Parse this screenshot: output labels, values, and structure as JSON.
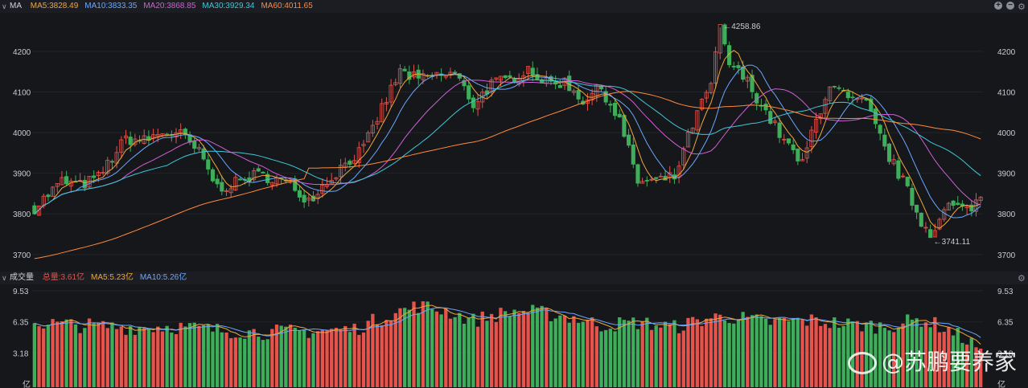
{
  "header_main": {
    "label": "MA",
    "items": [
      {
        "text": "MA5:3828.49",
        "color": "#f0a73b"
      },
      {
        "text": "MA10:3833.35",
        "color": "#6aa8ff"
      },
      {
        "text": "MA20:3868.85",
        "color": "#d35ed8"
      },
      {
        "text": "MA30:3929.34",
        "color": "#3ec8d8"
      },
      {
        "text": "MA60:4011.65",
        "color": "#ff8a3d"
      }
    ]
  },
  "header_vol": {
    "label": "成交量",
    "items": [
      {
        "text": "总量:3.61亿",
        "color": "#e5534b"
      },
      {
        "text": "MA5:5.23亿",
        "color": "#f0a73b"
      },
      {
        "text": "MA10:5.26亿",
        "color": "#6aa8ff"
      }
    ]
  },
  "watermark": "@苏鹏要养家",
  "colors": {
    "up": "#e5534b",
    "down": "#3fae5a",
    "ma5": "#f0a73b",
    "ma10": "#6aa8ff",
    "ma20": "#d35ed8",
    "ma30": "#3ec8d8",
    "ma60": "#ff8a3d"
  },
  "chart_data": [
    {
      "type": "candlestick",
      "title": "",
      "ylim": [
        3670,
        4275
      ],
      "y_ticks": [
        "4200",
        "4100",
        "4000",
        "3900",
        "3800",
        "3700"
      ],
      "annotations": [
        {
          "text": "←4258.86",
          "value": 4258.86,
          "index": 150
        },
        {
          "text": "←3741.11",
          "value": 3741.11,
          "index": 196
        }
      ],
      "anchors": [
        [
          0,
          3815
        ],
        [
          6,
          3880
        ],
        [
          10,
          3870
        ],
        [
          14,
          3890
        ],
        [
          20,
          3985
        ],
        [
          24,
          3980
        ],
        [
          28,
          4000
        ],
        [
          32,
          3995
        ],
        [
          36,
          3950
        ],
        [
          40,
          3865
        ],
        [
          44,
          3875
        ],
        [
          48,
          3895
        ],
        [
          52,
          3890
        ],
        [
          56,
          3870
        ],
        [
          60,
          3835
        ],
        [
          64,
          3880
        ],
        [
          68,
          3925
        ],
        [
          72,
          3960
        ],
        [
          76,
          4060
        ],
        [
          80,
          4150
        ],
        [
          84,
          4130
        ],
        [
          88,
          4140
        ],
        [
          92,
          4145
        ],
        [
          96,
          4070
        ],
        [
          100,
          4120
        ],
        [
          104,
          4130
        ],
        [
          108,
          4160
        ],
        [
          112,
          4120
        ],
        [
          116,
          4125
        ],
        [
          120,
          4080
        ],
        [
          124,
          4110
        ],
        [
          128,
          4030
        ],
        [
          132,
          3880
        ],
        [
          136,
          3880
        ],
        [
          140,
          3890
        ],
        [
          144,
          4020
        ],
        [
          148,
          4120
        ],
        [
          150,
          4255
        ],
        [
          152,
          4170
        ],
        [
          156,
          4125
        ],
        [
          160,
          4050
        ],
        [
          164,
          3980
        ],
        [
          168,
          3920
        ],
        [
          170,
          4000
        ],
        [
          174,
          4120
        ],
        [
          178,
          4080
        ],
        [
          182,
          4070
        ],
        [
          186,
          3960
        ],
        [
          190,
          3880
        ],
        [
          194,
          3780
        ],
        [
          196,
          3755
        ],
        [
          200,
          3820
        ],
        [
          204,
          3810
        ],
        [
          207,
          3840
        ]
      ],
      "candle_count": 208,
      "series": [
        {
          "name": "MA5",
          "value_last": 3828.49
        },
        {
          "name": "MA10",
          "value_last": 3833.35
        },
        {
          "name": "MA20",
          "value_last": 3868.85
        },
        {
          "name": "MA30",
          "value_last": 3929.34
        },
        {
          "name": "MA60",
          "value_last": 4011.65
        }
      ]
    },
    {
      "type": "bar",
      "ylim": [
        0,
        9.53
      ],
      "y_ticks": [
        "9.53",
        "6.35",
        "3.18",
        "亿"
      ],
      "total": 3.61,
      "anchors": [
        [
          0,
          6.3
        ],
        [
          10,
          6.0
        ],
        [
          20,
          5.8
        ],
        [
          30,
          5.9
        ],
        [
          40,
          5.5
        ],
        [
          50,
          5.3
        ],
        [
          60,
          5.4
        ],
        [
          70,
          5.6
        ],
        [
          78,
          7.2
        ],
        [
          84,
          8.0
        ],
        [
          90,
          7.5
        ],
        [
          96,
          6.5
        ],
        [
          100,
          7.0
        ],
        [
          106,
          7.5
        ],
        [
          112,
          7.2
        ],
        [
          118,
          6.8
        ],
        [
          124,
          6.0
        ],
        [
          132,
          6.3
        ],
        [
          140,
          5.8
        ],
        [
          148,
          6.8
        ],
        [
          152,
          6.9
        ],
        [
          160,
          6.3
        ],
        [
          170,
          6.5
        ],
        [
          178,
          6.1
        ],
        [
          186,
          5.9
        ],
        [
          194,
          6.6
        ],
        [
          200,
          5.6
        ],
        [
          207,
          3.61
        ]
      ]
    }
  ]
}
